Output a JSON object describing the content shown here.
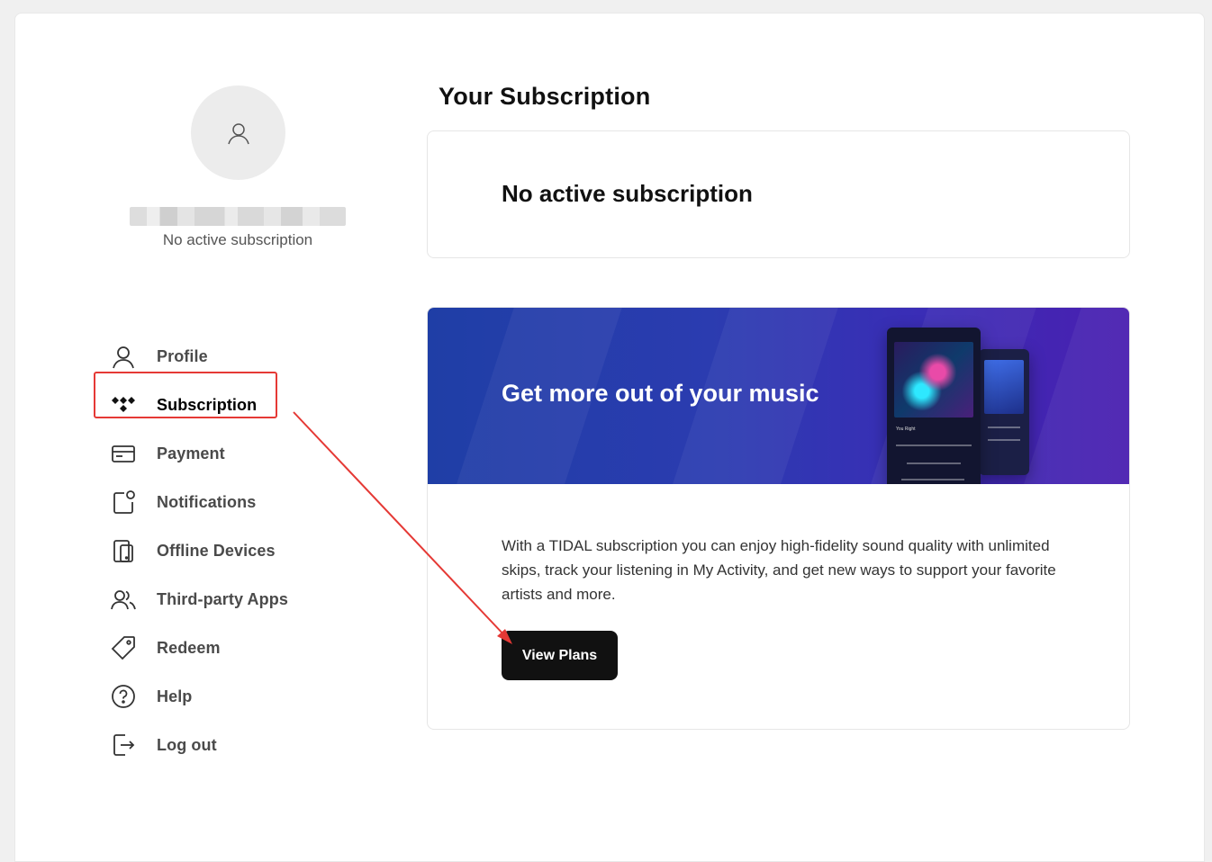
{
  "user": {
    "subscription_status": "No active subscription"
  },
  "sidebar": {
    "items": [
      {
        "label": "Profile",
        "icon": "user-icon"
      },
      {
        "label": "Subscription",
        "icon": "tidal-logo-icon"
      },
      {
        "label": "Payment",
        "icon": "credit-card-icon"
      },
      {
        "label": "Notifications",
        "icon": "notification-icon"
      },
      {
        "label": "Offline Devices",
        "icon": "devices-icon"
      },
      {
        "label": "Third-party Apps",
        "icon": "users-icon"
      },
      {
        "label": "Redeem",
        "icon": "tag-icon"
      },
      {
        "label": "Help",
        "icon": "help-circle-icon"
      },
      {
        "label": "Log out",
        "icon": "logout-icon"
      }
    ],
    "active": "Subscription"
  },
  "main": {
    "title": "Your Subscription",
    "status_card": {
      "text": "No active subscription"
    },
    "promo": {
      "title": "Get more out of your music",
      "body": "With a TIDAL subscription you can enjoy high-fidelity sound quality with unlimited skips, track your listening in My Activity, and get new ways to support your favorite artists and more.",
      "button_label": "View Plans",
      "phone_track": "You Right"
    }
  },
  "colors": {
    "annotation_red": "#e53935",
    "banner_start": "#1f3ea6",
    "banner_end": "#4a1fb0",
    "button_bg": "#111111"
  }
}
